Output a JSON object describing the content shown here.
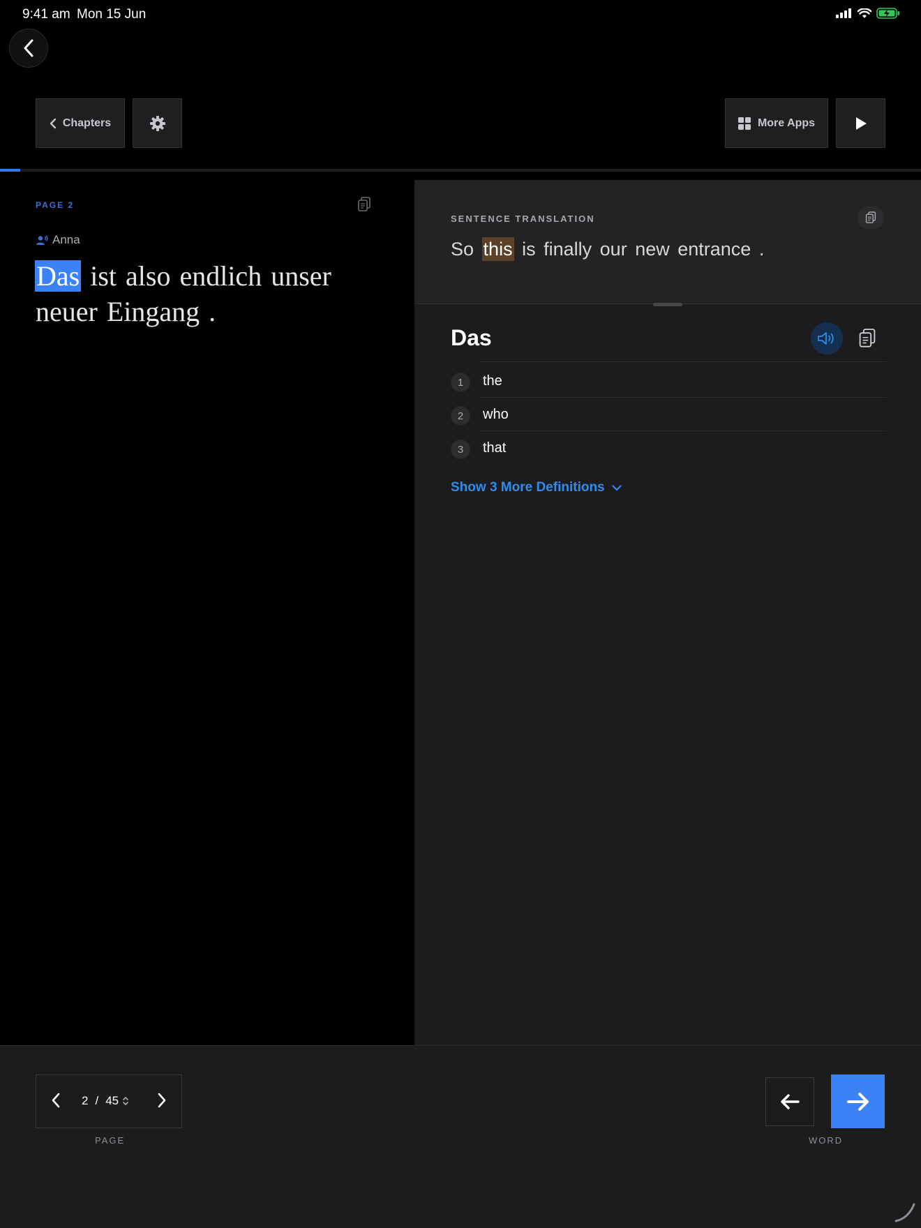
{
  "status_bar": {
    "time": "9:41 am",
    "date": "Mon 15 Jun"
  },
  "toolbar": {
    "chapters_label": "Chapters",
    "more_apps_label": "More Apps"
  },
  "progress": {
    "fraction": 0.022,
    "color": "#2f7bf5"
  },
  "reader": {
    "page_label": "PAGE  2",
    "speaker": "Anna",
    "words": [
      "Das",
      "ist",
      "also",
      "endlich",
      "unser",
      "neuer",
      "Eingang",
      "."
    ],
    "highlighted_word_index": 0
  },
  "translation": {
    "label": "SENTENCE TRANSLATION",
    "words": [
      "So",
      "this",
      "is",
      "finally",
      "our",
      "new",
      "entrance",
      "."
    ],
    "highlighted_word_index": 1
  },
  "dictionary": {
    "word": "Das",
    "definitions": [
      {
        "number": "1",
        "text": "the"
      },
      {
        "number": "2",
        "text": "who"
      },
      {
        "number": "3",
        "text": "that"
      }
    ],
    "show_more_label": "Show 3 More Definitions"
  },
  "pager": {
    "current": "2",
    "separator": "/",
    "total": "45",
    "label": "PAGE"
  },
  "word_nav": {
    "label": "WORD"
  },
  "colors": {
    "accent": "#3b82f6",
    "link": "#2f8cf0",
    "translation_highlight": "#5a4128",
    "battery": "#34c759"
  }
}
